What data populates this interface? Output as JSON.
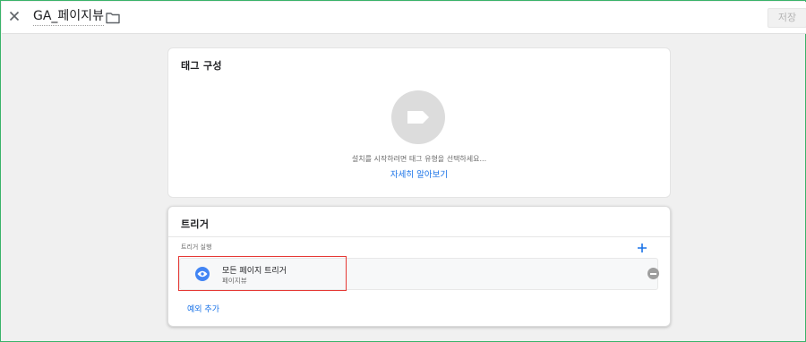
{
  "header": {
    "title": "GA_페이지뷰",
    "save_label": "저장",
    "close_icon": "close-icon",
    "folder_icon": "folder-icon"
  },
  "tag_config": {
    "title": "태그 구성",
    "hint": "설치를 시작하려면 태그 유형을 선택하세요...",
    "learn_more": "자세히 알아보기",
    "tag_icon": "tag-icon"
  },
  "triggering": {
    "title": "트리거",
    "section_label": "트리거 실행",
    "add_icon": "plus-icon",
    "items": [
      {
        "name": "모든 페이지 트리거",
        "type": "페이지뷰",
        "icon": "eye-icon"
      }
    ],
    "add_exception": "예외 추가"
  },
  "colors": {
    "accent": "#1a73e8",
    "trigger_icon_bg": "#4285f4",
    "highlight": "#e53935",
    "frame_border": "#3ab36a"
  }
}
